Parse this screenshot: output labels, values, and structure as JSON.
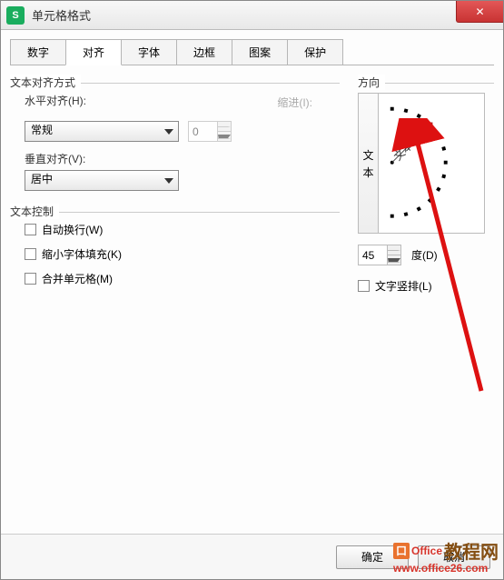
{
  "window": {
    "title": "单元格格式"
  },
  "tabs": [
    "数字",
    "对齐",
    "字体",
    "边框",
    "图案",
    "保护"
  ],
  "activeTab": "对齐",
  "alignGroup": {
    "title": "文本对齐方式",
    "horizontal": {
      "label": "水平对齐(H):",
      "value": "常规"
    },
    "indent": {
      "label": "缩进(I):",
      "value": "0"
    },
    "vertical": {
      "label": "垂直对齐(V):",
      "value": "居中"
    }
  },
  "textControl": {
    "title": "文本控制",
    "wrap": "自动换行(W)",
    "shrink": "缩小字体填充(K)",
    "merge": "合并单元格(M)"
  },
  "orientation": {
    "title": "方向",
    "vbutton": [
      "文",
      "本"
    ],
    "degrees": "45",
    "degreeLabel": "度(D)",
    "verticalCheck": "文字竖排(L)"
  },
  "footer": {
    "ok": "确定",
    "cancel": "取消"
  },
  "watermark": {
    "brand_left": "Office",
    "brand_right": "教程网",
    "url": "www.office26.com"
  }
}
